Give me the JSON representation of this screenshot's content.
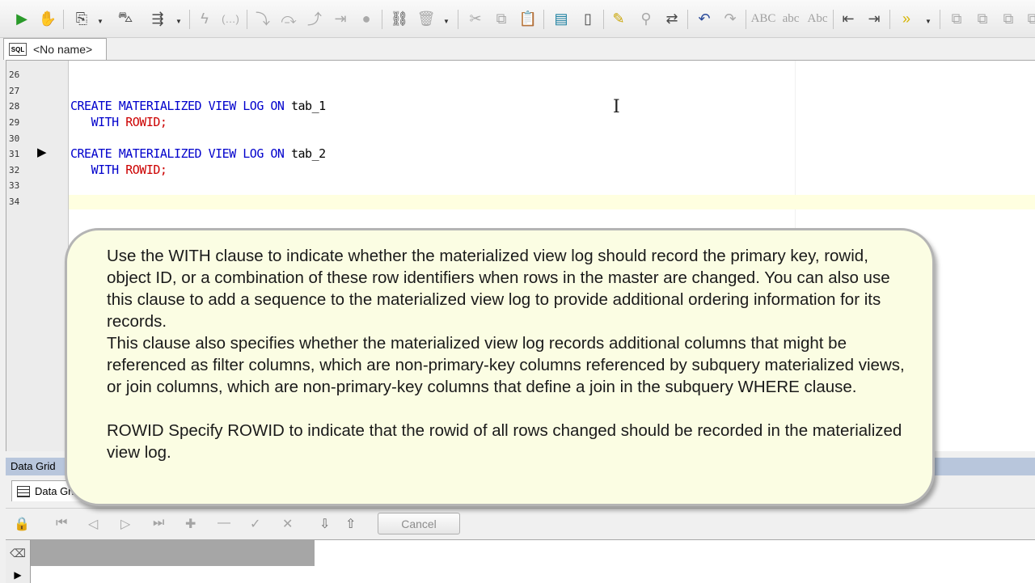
{
  "toolbar": {
    "icons": [
      "execute-icon",
      "stop-icon",
      "commit-icon",
      "explain-plan-icon",
      "debug-icon",
      "compile-icon",
      "param-icon",
      "step-into-icon",
      "step-over-icon",
      "step-out-icon",
      "run-to-cursor-icon",
      "breakpoint-icon",
      "add-watch-icon",
      "delete-watch-icon",
      "cut-icon",
      "copy-icon",
      "paste-icon",
      "format-icon",
      "new-icon",
      "highlight-icon",
      "find-icon",
      "replace-icon",
      "undo-icon",
      "redo-icon",
      "upper-icon",
      "lower-icon",
      "title-icon",
      "indent-icon",
      "outdent-icon",
      "more-icon",
      "misc1-icon",
      "misc2-icon",
      "misc3-icon"
    ],
    "case_upper": "ABC",
    "case_lower": "abc",
    "case_title": "Abc"
  },
  "tab": {
    "icon_text": "SQL",
    "label": "<No name>"
  },
  "editor": {
    "line_numbers": [
      "26",
      "27",
      "28",
      "29",
      "30",
      "31",
      "32",
      "33",
      "34"
    ],
    "lines": [
      {
        "kw1": "CREATE MATERIALIZED VIEW LOG ON",
        "rest": " tab_1"
      },
      {
        "kw": "WITH",
        "red": "ROWID;"
      },
      {
        "kw1": "CREATE MATERIALIZED VIEW LOG ON",
        "rest": " tab_2"
      },
      {
        "kw": "WITH",
        "red": "ROWID;"
      }
    ]
  },
  "callout": {
    "paragraph1": "Use the WITH clause to indicate whether the materialized view log should record the primary key, rowid, object ID, or a combination of these row identifiers when rows in the master are changed. You can also use this clause to add a sequence to the materialized view log to provide additional ordering information for its records.",
    "paragraph2": "This clause also specifies whether the materialized view log records additional columns that might be referenced as filter columns, which are non-primary-key columns referenced by subquery materialized views, or join columns, which are non-primary-key columns that define a join in the subquery WHERE clause.",
    "paragraph3": "ROWID Specify ROWID to indicate that the rowid of all rows changed should be recorded in the materialized view log."
  },
  "data_grid": {
    "header": "Data Grid",
    "tab_label": "Data Grid",
    "cancel_label": "Cancel"
  },
  "colors": {
    "keyword": "#0000cc",
    "rowid": "#cc0000",
    "callout_bg": "#fbfde3",
    "grid_header": "#b8c6dc"
  }
}
